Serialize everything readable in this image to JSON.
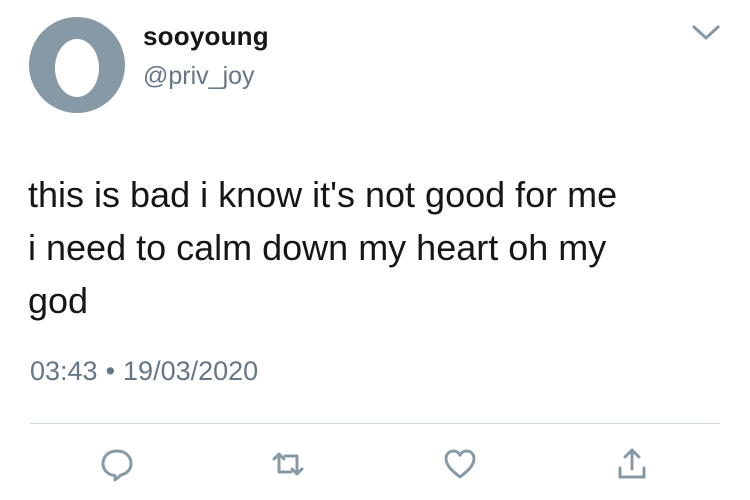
{
  "tweet": {
    "author": {
      "display_name": "sooyoung",
      "handle": "@priv_joy"
    },
    "text_lines": [
      "this is bad i know it's not good for me",
      "i need to calm down my heart oh my",
      "god"
    ],
    "time": "03:43",
    "separator": "•",
    "date": "19/03/2020"
  },
  "icons": {
    "menu": "chevron-down-icon",
    "reply": "reply-icon",
    "retweet": "retweet-icon",
    "like": "heart-icon",
    "share": "share-icon"
  },
  "colors": {
    "text_primary": "#14171a",
    "text_secondary": "#657786",
    "avatar_background": "#8899a6",
    "icon_gray": "#8899a6",
    "divider": "#ccd6dd",
    "background": "#ffffff"
  }
}
